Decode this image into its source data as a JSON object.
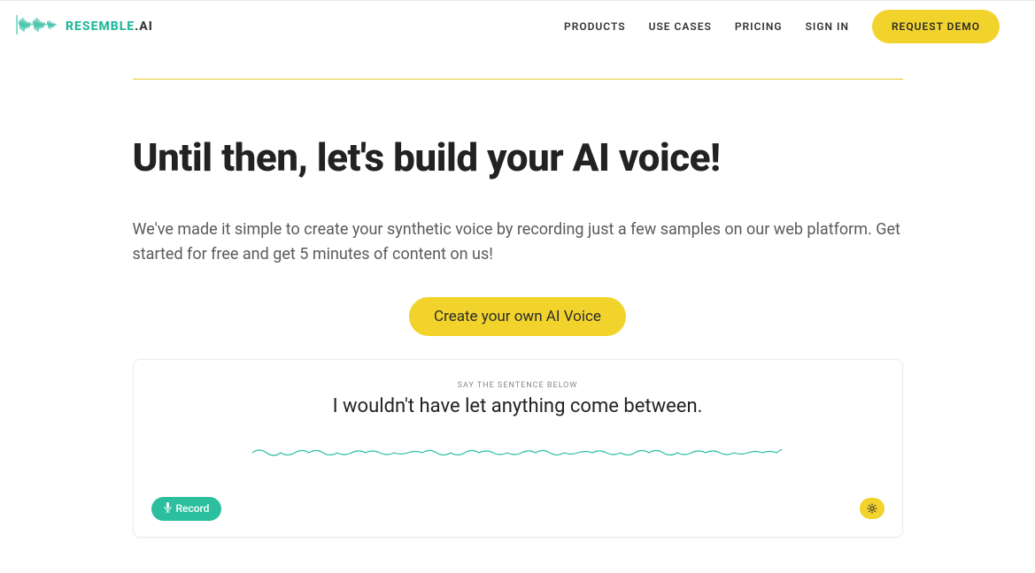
{
  "brand": {
    "name_main": "RESEMBLE",
    "name_suffix": ".AI"
  },
  "nav": {
    "items": [
      "PRODUCTS",
      "USE CASES",
      "PRICING",
      "SIGN IN"
    ],
    "cta": "REQUEST DEMO"
  },
  "hero": {
    "headline": "Until then, let's build your AI voice!",
    "subtext": "We've made it simple to create your synthetic voice by recording just a few samples on our web platform. Get started for free and get 5 minutes of content on us!",
    "cta_label": "Create your own AI Voice"
  },
  "recorder": {
    "prompt_label": "SAY THE SENTENCE BELOW",
    "prompt_sentence": "I wouldn't have let anything come between.",
    "record_label": "Record"
  },
  "colors": {
    "accent_yellow": "#f2d32c",
    "accent_teal": "#2bbf9e",
    "logo_teal": "#20b89c"
  }
}
